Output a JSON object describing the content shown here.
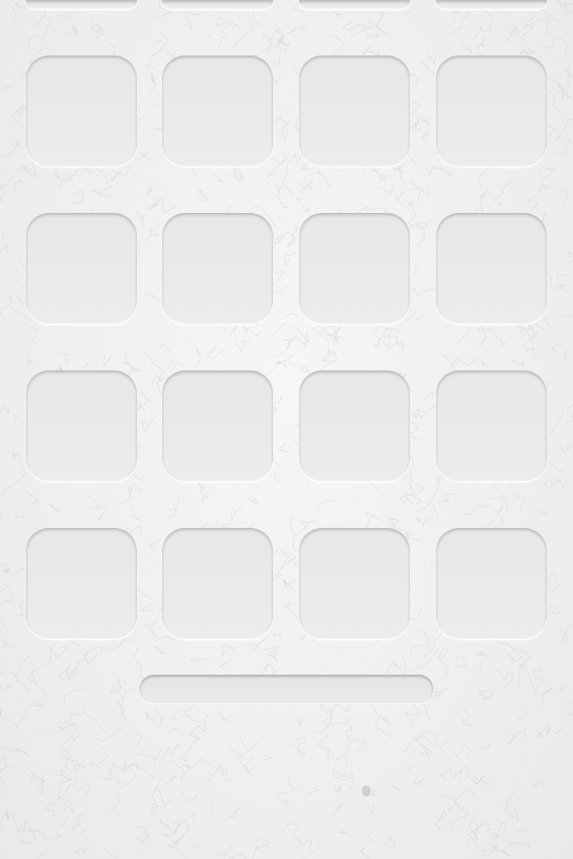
{
  "screen": {
    "type": "home-screen-wallpaper",
    "wallpaper_texture": "white-leather",
    "colors": {
      "background": "#f0f0f0",
      "slot_fill": "#e8e8e8",
      "crack_lines": "#c8c8c8"
    }
  },
  "grid": {
    "rows": 4,
    "columns": 4,
    "partial_top_row_slots": 4,
    "slot_shape": "rounded-square",
    "slots_empty": true
  },
  "page_bar": {
    "shape": "pill",
    "empty": true
  }
}
